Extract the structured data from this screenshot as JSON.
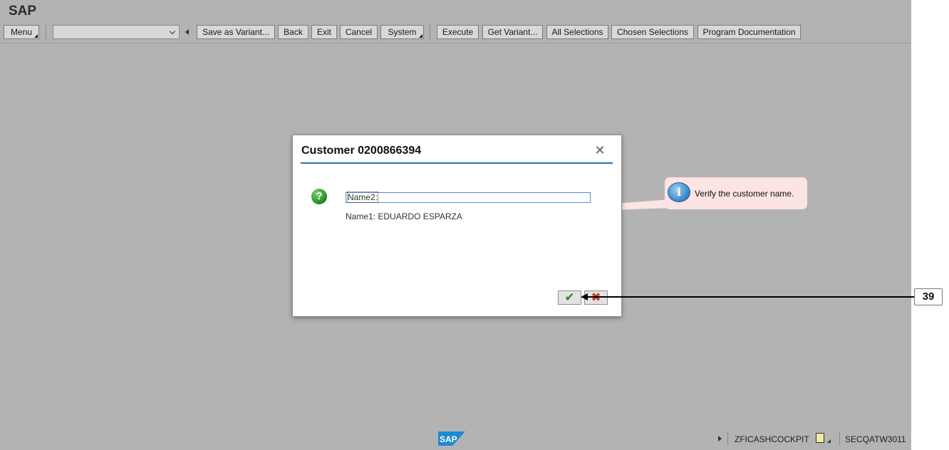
{
  "app": {
    "title": "SAP"
  },
  "toolbar": {
    "menu_label": "Menu",
    "variant_select": {
      "value": ""
    },
    "buttons": [
      "Save as Variant...",
      "Back",
      "Exit",
      "Cancel",
      "System",
      "Execute",
      "Get Variant...",
      "All Selections",
      "Chosen Selections",
      "Program Documentation"
    ]
  },
  "dialog": {
    "title": "Customer 0200866394",
    "close_glyph": "✕",
    "question_glyph": "?",
    "name2_field": "Name2:",
    "name1_text": "Name1: EDUARDO ESPARZA",
    "ok_glyph": "✔",
    "cancel_glyph": "✖"
  },
  "callout": {
    "text": "Verify the customer name.",
    "icon_glyph": "i"
  },
  "step": {
    "number": "39"
  },
  "statusbar": {
    "logo_text": "SAP",
    "transaction": "ZFICASHCOCKPIT",
    "system": "SECQATW3011"
  },
  "colors": {
    "background": "#b3b3b3",
    "dialog_rule": "#2d6ea0",
    "callout": "#fce3e4",
    "ok": "#2f8a28",
    "cancel": "#c44231",
    "sap_logo": "#1d8ad6"
  }
}
